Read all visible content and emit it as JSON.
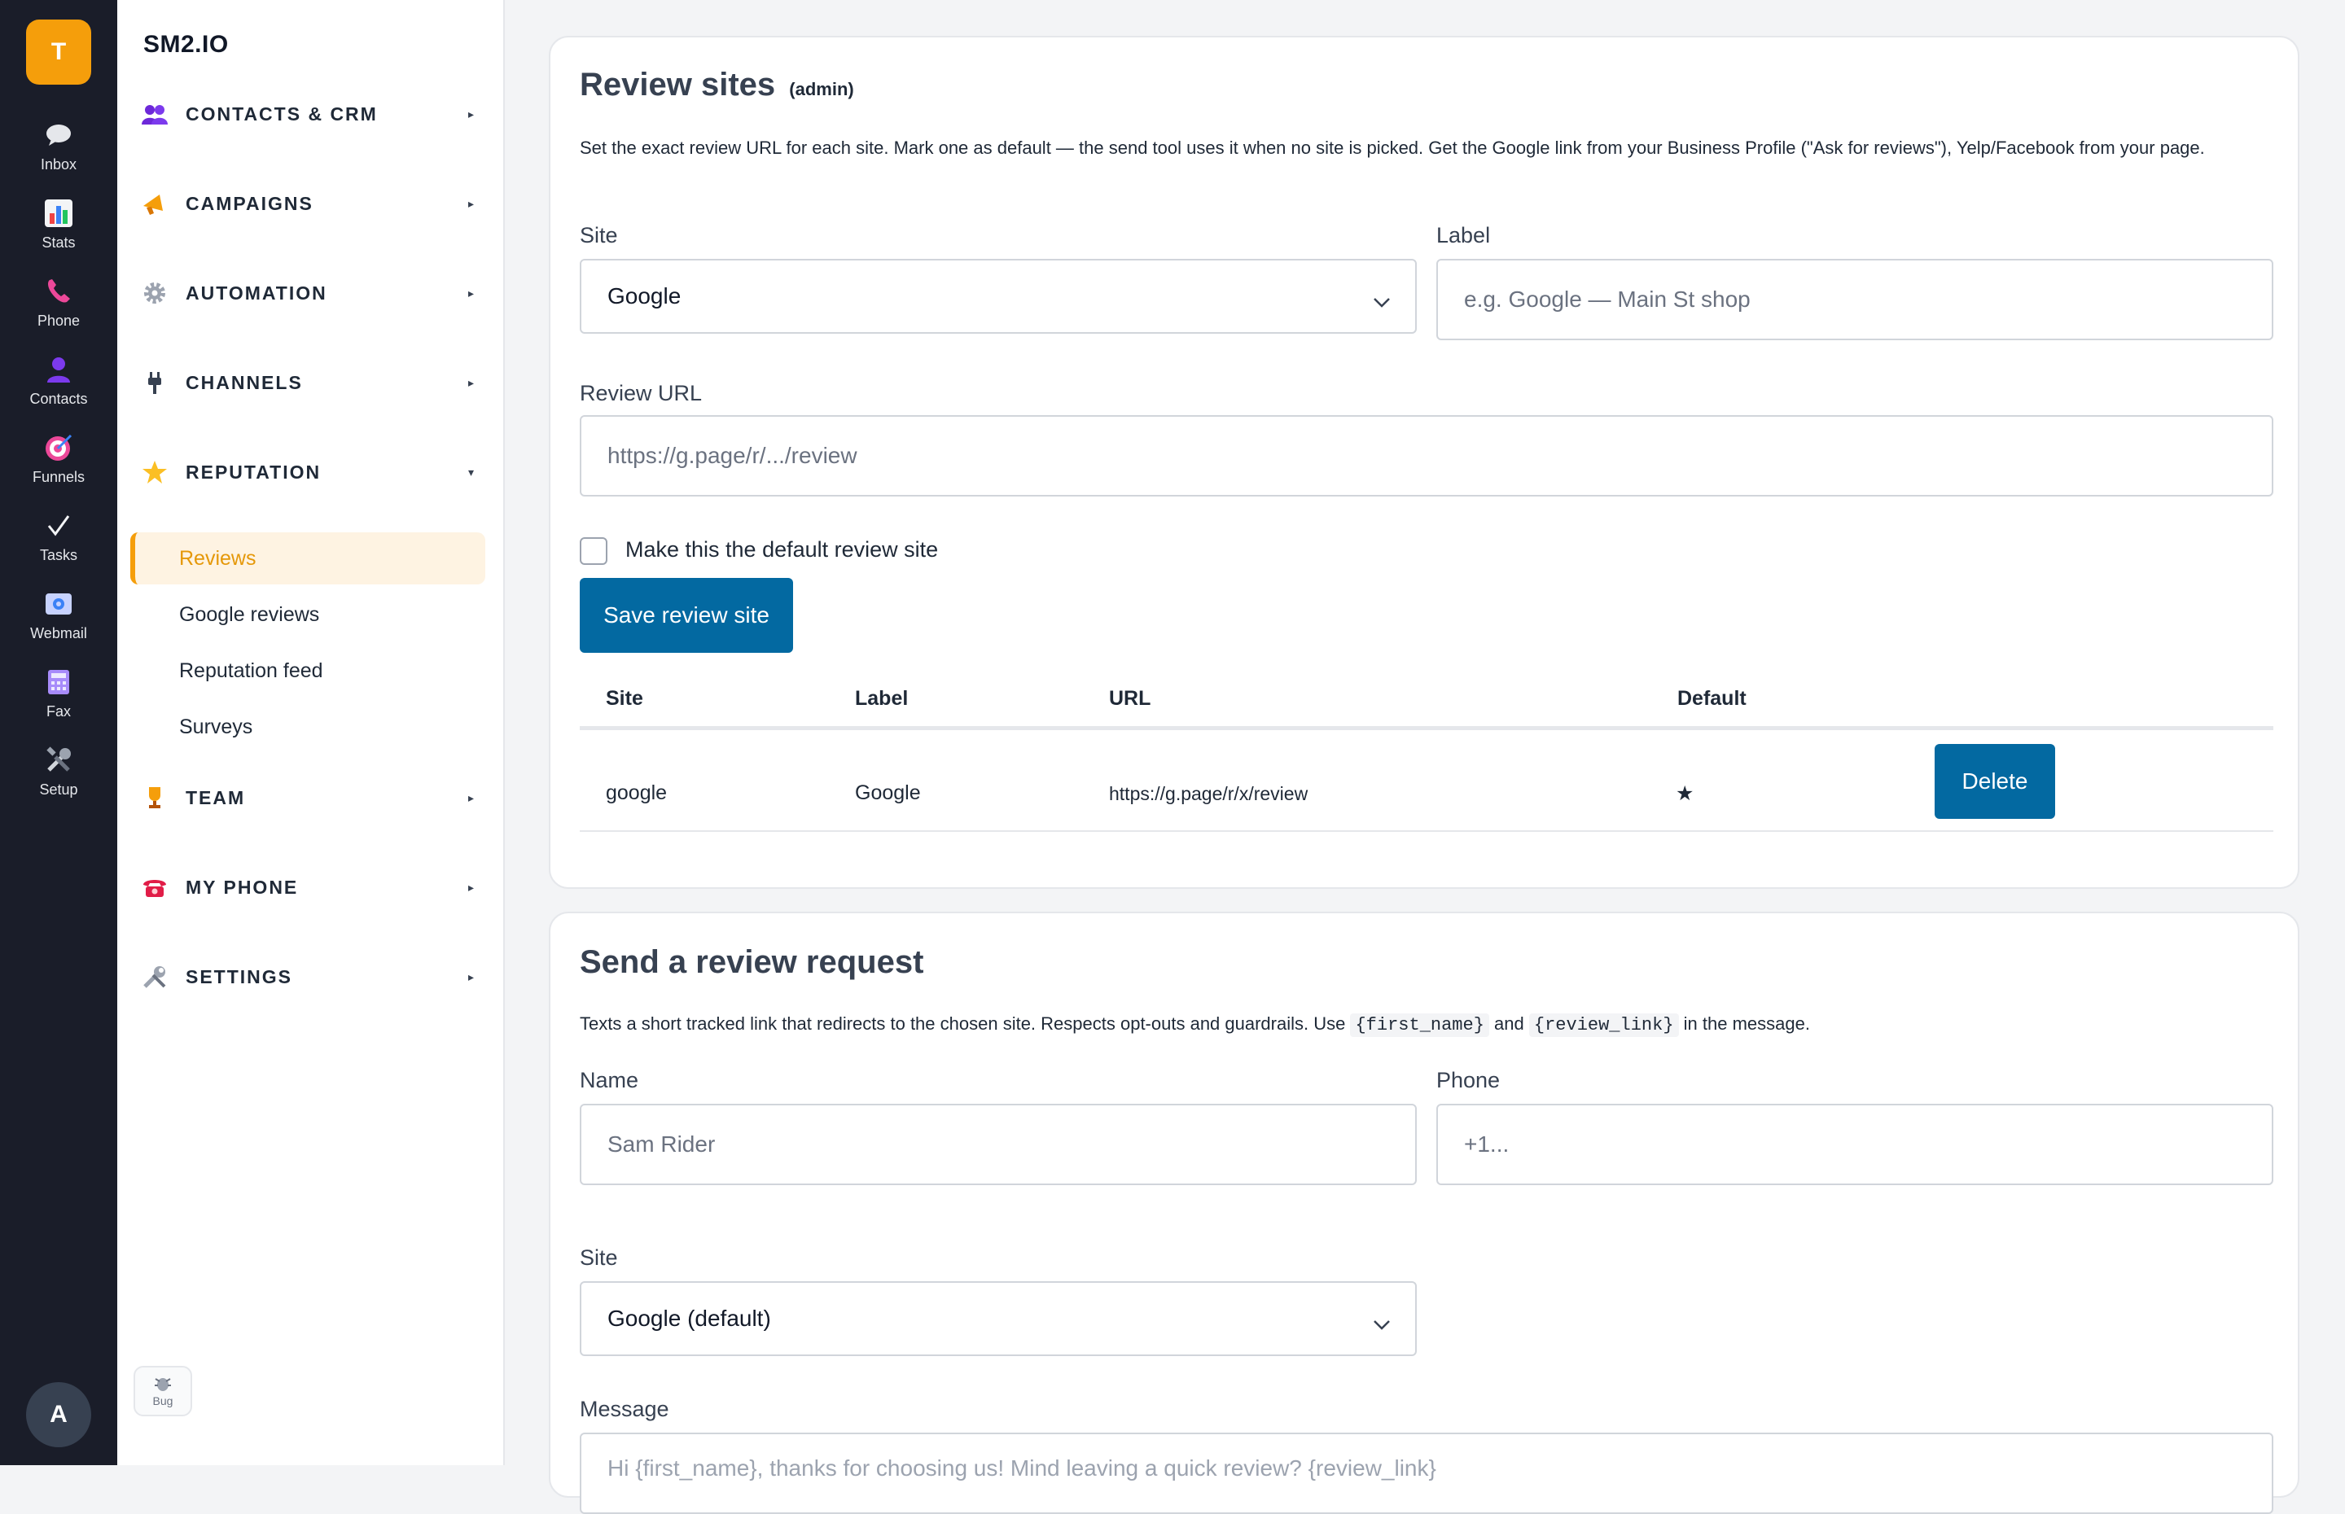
{
  "rail": {
    "logo_letter": "T",
    "items": [
      {
        "label": "Inbox",
        "icon": "speech-bubble-icon"
      },
      {
        "label": "Stats",
        "icon": "bar-chart-icon"
      },
      {
        "label": "Phone",
        "icon": "phone-icon"
      },
      {
        "label": "Contacts",
        "icon": "person-icon"
      },
      {
        "label": "Funnels",
        "icon": "target-icon"
      },
      {
        "label": "Tasks",
        "icon": "check-icon"
      },
      {
        "label": "Webmail",
        "icon": "mail-icon"
      },
      {
        "label": "Fax",
        "icon": "fax-icon"
      },
      {
        "label": "Setup",
        "icon": "tools-icon"
      }
    ],
    "avatar_letter": "A"
  },
  "sidebar": {
    "brand": "SM2.IO",
    "sections": [
      {
        "label": "CONTACTS & CRM",
        "icon": "people-icon",
        "caret": "▸"
      },
      {
        "label": "CAMPAIGNS",
        "icon": "megaphone-icon",
        "caret": "▸"
      },
      {
        "label": "AUTOMATION",
        "icon": "gear-icon",
        "caret": "▸"
      },
      {
        "label": "CHANNELS",
        "icon": "plug-icon",
        "caret": "▸"
      },
      {
        "label": "REPUTATION",
        "icon": "star-icon",
        "caret": "▾"
      },
      {
        "label": "TEAM",
        "icon": "trophy-icon",
        "caret": "▸"
      },
      {
        "label": "MY PHONE",
        "icon": "telephone-icon",
        "caret": "▸"
      },
      {
        "label": "SETTINGS",
        "icon": "wrench-icon",
        "caret": "▸"
      }
    ],
    "reputation_items": [
      "Reviews",
      "Google reviews",
      "Reputation feed",
      "Surveys"
    ],
    "bug_label": "Bug"
  },
  "review_sites": {
    "title": "Review sites",
    "title_tag": "(admin)",
    "description": "Set the exact review URL for each site. Mark one as default — the send tool uses it when no site is picked. Get the Google link from your Business Profile (\"Ask for reviews\"), Yelp/Facebook from your page.",
    "site_label": "Site",
    "site_value": "Google",
    "label_label": "Label",
    "label_placeholder": "e.g. Google — Main St shop",
    "url_label": "Review URL",
    "url_placeholder": "https://g.page/r/.../review",
    "default_checkbox_label": "Make this the default review site",
    "save_button": "Save review site",
    "table": {
      "headers": [
        "Site",
        "Label",
        "URL",
        "Default"
      ],
      "rows": [
        {
          "site": "google",
          "label": "Google",
          "url": "https://g.page/r/x/review",
          "default": "★",
          "action": "Delete"
        }
      ]
    }
  },
  "send_request": {
    "title": "Send a review request",
    "desc_before": "Texts a short tracked link that redirects to the chosen site. Respects opt-outs and guardrails. Use",
    "code_first": "{first_name}",
    "desc_and": "and",
    "code_link": "{review_link}",
    "desc_after": "in the message.",
    "name_label": "Name",
    "name_placeholder": "Sam Rider",
    "phone_label": "Phone",
    "phone_placeholder": "+1...",
    "site_label": "Site",
    "site_value": "Google (default)",
    "message_label": "Message",
    "message_value": "Hi {first_name}, thanks for choosing us! Mind leaving a quick review? {review_link}"
  },
  "colors": {
    "rail_bg": "#1a1d29",
    "accent": "#f59e0b",
    "primary": "#0369a1"
  }
}
